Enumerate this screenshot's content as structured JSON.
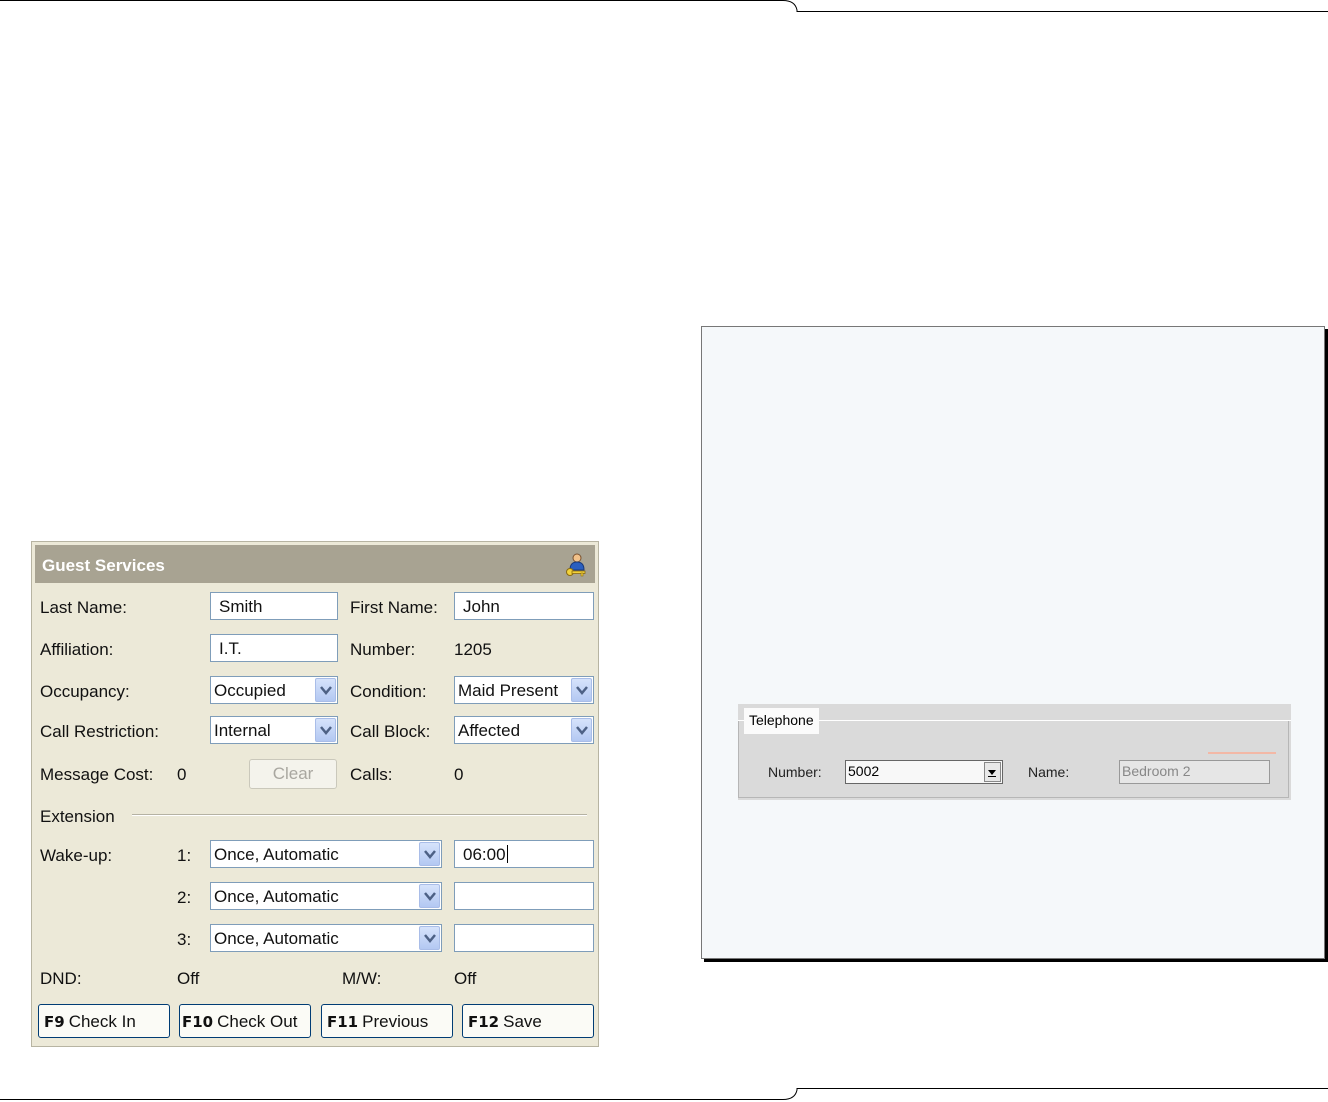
{
  "guest_services": {
    "title": "Guest Services",
    "header_icon": "guest-key-icon",
    "last_name_label": "Last Name:",
    "last_name_value": "Smith",
    "first_name_label": "First Name:",
    "first_name_value": "John",
    "affiliation_label": "Affiliation:",
    "affiliation_value": "I.T.",
    "number_label": "Number:",
    "number_value": "1205",
    "occupancy_label": "Occupancy:",
    "occupancy_value": "Occupied",
    "condition_label": "Condition:",
    "condition_value": "Maid Present",
    "call_restriction_label": "Call Restriction:",
    "call_restriction_value": "Internal",
    "call_block_label": "Call Block:",
    "call_block_value": "Affected",
    "message_cost_label": "Message Cost:",
    "message_cost_value": "0",
    "clear_label": "Clear",
    "calls_label": "Calls:",
    "calls_value": "0",
    "extension_label": "Extension",
    "wakeup_label": "Wake-up:",
    "wakeups": [
      {
        "index": "1:",
        "mode": "Once, Automatic",
        "time": "06:00"
      },
      {
        "index": "2:",
        "mode": "Once, Automatic",
        "time": ""
      },
      {
        "index": "3:",
        "mode": "Once, Automatic",
        "time": ""
      }
    ],
    "dnd_label": "DND:",
    "dnd_value": "Off",
    "mw_label": "M/W:",
    "mw_value": "Off",
    "buttons": [
      {
        "key": "F9",
        "label": "Check In"
      },
      {
        "key": "F10",
        "label": "Check Out"
      },
      {
        "key": "F11",
        "label": "Previous"
      },
      {
        "key": "F12",
        "label": "Save"
      }
    ],
    "colors": {
      "header": "#a8a392",
      "panel": "#ece9d8",
      "field_border": "#7f9db9",
      "button_border": "#003c74"
    }
  },
  "telephone": {
    "group_label": "Telephone",
    "number_label": "Number:",
    "number_value": "5002",
    "name_label": "Name:",
    "name_value": "Bedroom 2"
  }
}
